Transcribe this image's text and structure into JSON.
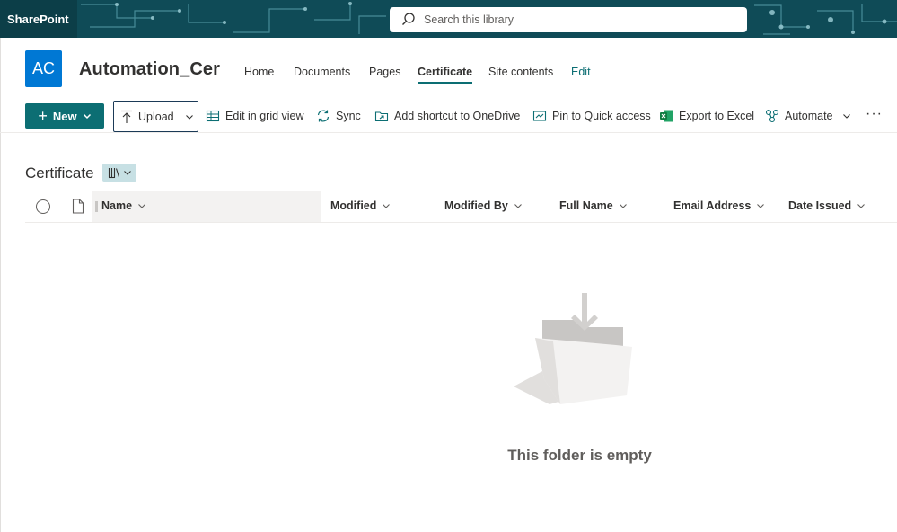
{
  "suite": {
    "brand": "SharePoint",
    "search_placeholder": "Search this library"
  },
  "site": {
    "logo_initials": "AC",
    "title": "Automation_Cer",
    "nav": [
      {
        "label": "Home"
      },
      {
        "label": "Documents"
      },
      {
        "label": "Pages"
      },
      {
        "label": "Certificate",
        "active": true
      },
      {
        "label": "Site contents"
      },
      {
        "label": "Edit"
      }
    ]
  },
  "commands": {
    "new_label": "New",
    "upload_label": "Upload",
    "grid_label": "Edit in grid view",
    "sync_label": "Sync",
    "shortcut_label": "Add shortcut to OneDrive",
    "pin_label": "Pin to Quick access",
    "excel_label": "Export to Excel",
    "automate_label": "Automate",
    "more_label": "···"
  },
  "library": {
    "title": "Certificate",
    "columns": [
      "Name",
      "Modified",
      "Modified By",
      "Full Name",
      "Email Address",
      "Date Issued"
    ],
    "empty_message": "This folder is empty"
  },
  "colors": {
    "suitebar": "#0f4b57",
    "accent": "#0c6e73",
    "logo": "#0078d4"
  }
}
